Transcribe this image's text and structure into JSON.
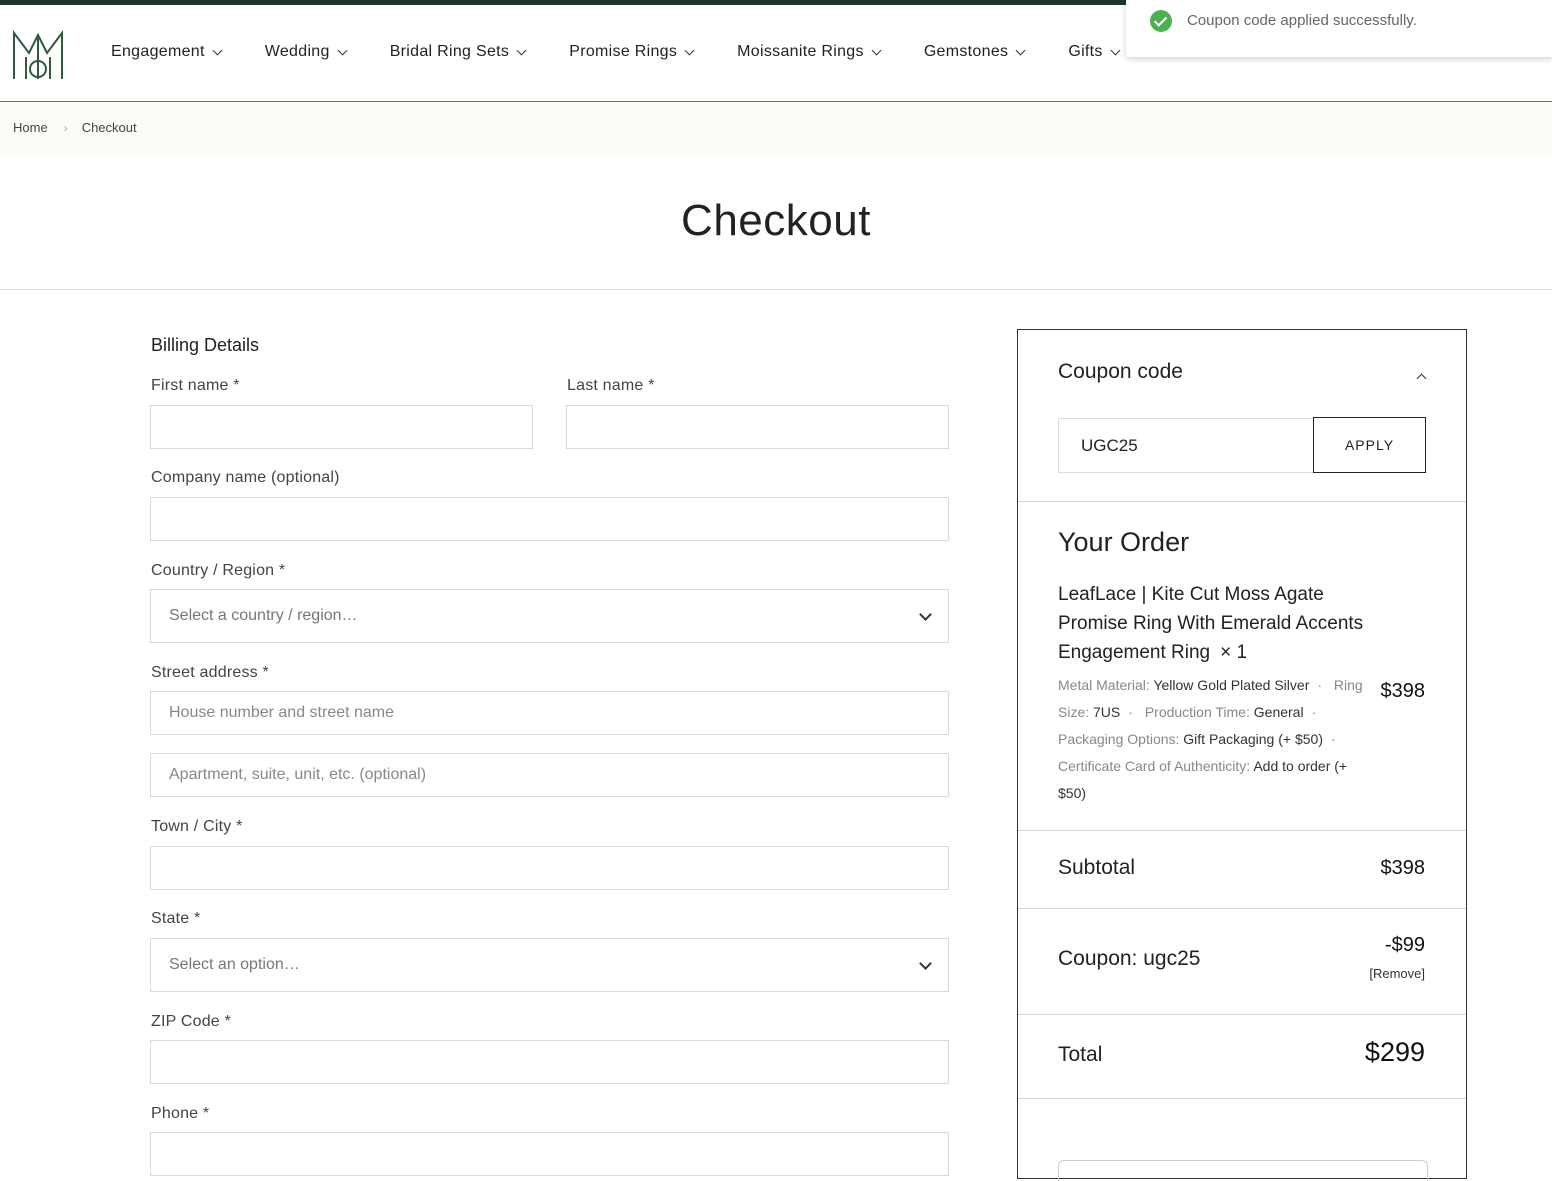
{
  "nav": {
    "items": [
      {
        "label": "Engagement"
      },
      {
        "label": "Wedding"
      },
      {
        "label": "Bridal Ring Sets"
      },
      {
        "label": "Promise Rings"
      },
      {
        "label": "Moissanite Rings"
      },
      {
        "label": "Gemstones"
      },
      {
        "label": "Gifts"
      }
    ]
  },
  "toast": {
    "message": "Coupon code applied successfully.",
    "icon": "check-circle-icon",
    "color": "#4caf50"
  },
  "breadcrumb": {
    "home": "Home",
    "current": "Checkout"
  },
  "page": {
    "title": "Checkout"
  },
  "billing": {
    "heading": "Billing Details",
    "first_name_label": "First name *",
    "last_name_label": "Last name *",
    "company_label": "Company name (optional)",
    "country_label": "Country / Region *",
    "country_value": "Select a country / region…",
    "street_label": "Street address *",
    "street_placeholder": "House number and street name",
    "apartment_placeholder": "Apartment, suite, unit, etc. (optional)",
    "city_label": "Town / City *",
    "state_label": "State *",
    "state_value": "Select an option…",
    "zip_label": "ZIP Code *",
    "phone_label": "Phone *"
  },
  "coupon": {
    "title": "Coupon code",
    "value": "UGC25",
    "apply_label": "APPLY"
  },
  "order": {
    "heading": "Your Order",
    "product": {
      "name": "LeafLace | Kite Cut Moss Agate Promise Ring With Emerald Accents Engagement Ring",
      "qty": "× 1",
      "price": "$398",
      "meta": [
        {
          "label": "Metal Material:",
          "value": "Yellow Gold Plated Silver"
        },
        {
          "label": "Ring Size:",
          "value": "7US"
        },
        {
          "label": "Production Time:",
          "value": "General"
        },
        {
          "label": "Packaging Options:",
          "value": "Gift Packaging (+ $50)"
        },
        {
          "label": "Certificate Card of Authenticity:",
          "value": "Add to order (+ $50)"
        }
      ]
    },
    "subtotal_label": "Subtotal",
    "subtotal_value": "$398",
    "coupon_label": "Coupon: ugc25",
    "coupon_value": "-$99",
    "remove_label": "[Remove]",
    "total_label": "Total",
    "total_value": "$299"
  }
}
